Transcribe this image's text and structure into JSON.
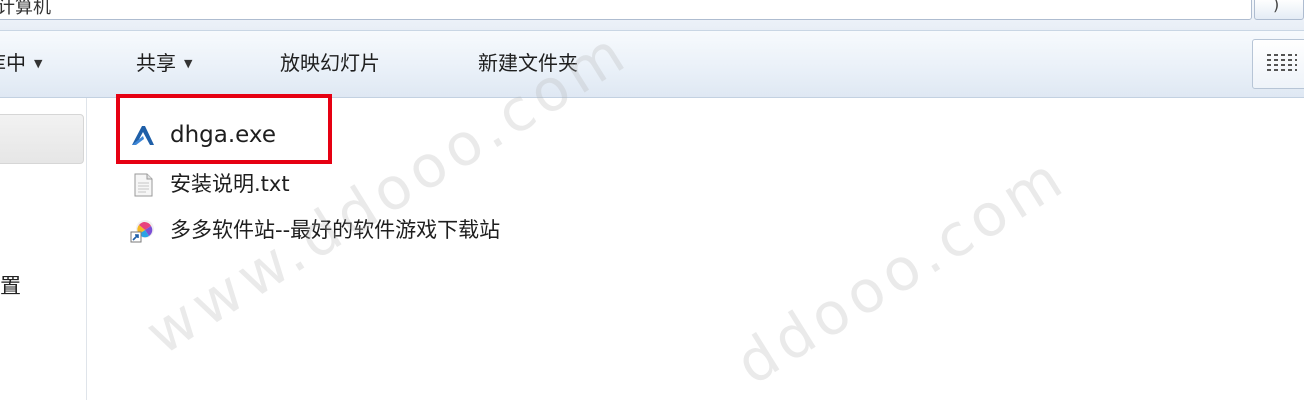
{
  "address_bar": {
    "partial_text": "计算机"
  },
  "toolbar": {
    "items": [
      {
        "label": "库中",
        "has_dropdown": true
      },
      {
        "label": "共享",
        "has_dropdown": true
      },
      {
        "label": "放映幻灯片",
        "has_dropdown": false
      },
      {
        "label": "新建文件夹",
        "has_dropdown": false
      }
    ],
    "dropdown_glyph": "▼"
  },
  "nav_pane": {
    "partial_label": "置"
  },
  "files": [
    {
      "name": "dhga.exe",
      "icon": "application-icon",
      "highlighted": true
    },
    {
      "name": "安装说明.txt",
      "icon": "text-file-icon"
    },
    {
      "name": "多多软件站--最好的软件游戏下载站",
      "icon": "shortcut-icon"
    }
  ],
  "colors": {
    "highlight": "#e60012",
    "toolbar_bg": "#e9f0f8"
  },
  "watermark": {
    "text_1": "www.ddooo.com",
    "text_2": "ddooo.com"
  }
}
